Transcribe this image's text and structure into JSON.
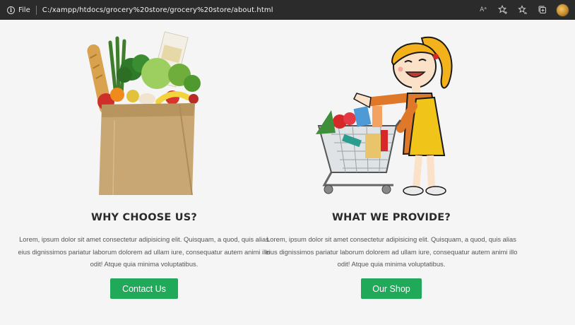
{
  "browser": {
    "file_label": "File",
    "url": "C:/xampp/htdocs/grocery%20store/grocery%20store/about.html",
    "read_aloud_glyph": "Aᵃ"
  },
  "sections": [
    {
      "heading": "WHY CHOOSE US?",
      "text": "Lorem, ipsum dolor sit amet consectetur adipisicing elit. Quisquam, a quod, quis alias eius dignissimos pariatur laborum dolorem ad ullam iure, consequatur autem animi illo odit! Atque quia minima voluptatibus.",
      "button": "Contact Us",
      "image_icon": "grocery-bag-illustration"
    },
    {
      "heading": "WHAT WE PROVIDE?",
      "text": "Lorem, ipsum dolor sit amet consectetur adipisicing elit. Quisquam, a quod, quis alias eius dignissimos pariatur laborum dolorem ad ullam iure, consequatur autem animi illo odit! Atque quia minima voluptatibus.",
      "button": "Our Shop",
      "image_icon": "shopper-with-cart-illustration"
    }
  ],
  "colors": {
    "page_bg": "#f5f5f5",
    "browser_bar": "#2b2b2b",
    "button_green": "#21a95a",
    "heading": "#2a2a2a",
    "body_text": "#555555"
  }
}
